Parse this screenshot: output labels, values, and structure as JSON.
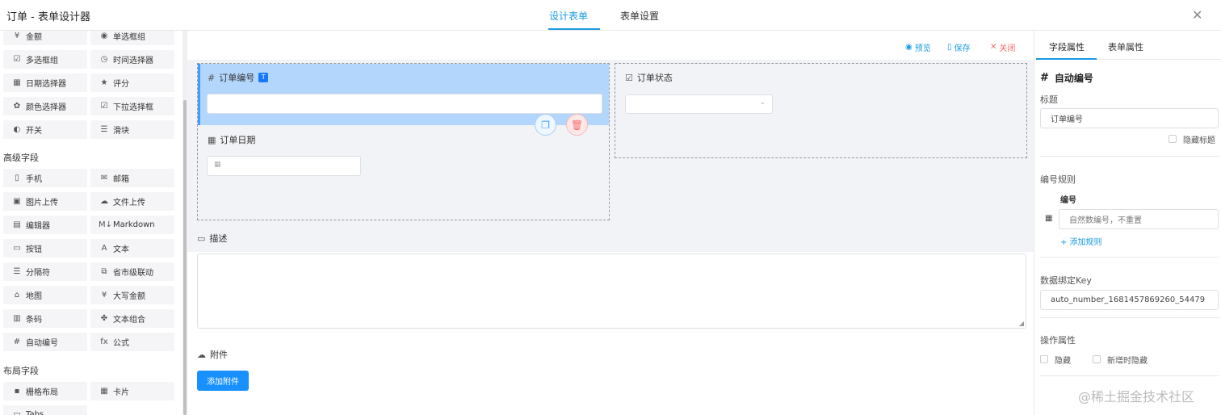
{
  "app": {
    "title": "订单 - 表单设计器",
    "close_glyph": "✕"
  },
  "top_tabs": [
    {
      "label": "设计表单",
      "active": true
    },
    {
      "label": "表单设置",
      "active": false
    }
  ],
  "sidebar": {
    "basic_items": [
      {
        "label": "金额",
        "icon": "money-icon"
      },
      {
        "label": "单选框组",
        "icon": "radio-icon"
      },
      {
        "label": "多选框组",
        "icon": "checkbox-icon"
      },
      {
        "label": "时间选择器",
        "icon": "clock-icon"
      },
      {
        "label": "日期选择器",
        "icon": "calendar-icon"
      },
      {
        "label": "评分",
        "icon": "star-icon"
      },
      {
        "label": "颜色选择器",
        "icon": "palette-icon"
      },
      {
        "label": "下拉选择框",
        "icon": "select-icon"
      },
      {
        "label": "开关",
        "icon": "switch-icon"
      },
      {
        "label": "滑块",
        "icon": "slider-icon"
      }
    ],
    "advanced_title": "高级字段",
    "advanced_items": [
      {
        "label": "手机",
        "icon": "phone-icon"
      },
      {
        "label": "邮箱",
        "icon": "mail-icon"
      },
      {
        "label": "图片上传",
        "icon": "image-icon"
      },
      {
        "label": "文件上传",
        "icon": "cloud-upload-icon"
      },
      {
        "label": "编辑器",
        "icon": "editor-icon"
      },
      {
        "label": "Markdown",
        "icon": "markdown-icon"
      },
      {
        "label": "按钮",
        "icon": "button-icon"
      },
      {
        "label": "文本",
        "icon": "text-icon"
      },
      {
        "label": "分隔符",
        "icon": "divider-icon"
      },
      {
        "label": "省市级联动",
        "icon": "cascade-icon"
      },
      {
        "label": "地图",
        "icon": "map-icon"
      },
      {
        "label": "大写金额",
        "icon": "money-upper-icon"
      },
      {
        "label": "条码",
        "icon": "barcode-icon"
      },
      {
        "label": "文本组合",
        "icon": "combine-icon"
      },
      {
        "label": "自动编号",
        "icon": "hash-icon"
      },
      {
        "label": "公式",
        "icon": "formula-icon"
      }
    ],
    "layout_title": "布局字段",
    "layout_items": [
      {
        "label": "栅格布局",
        "icon": "grid-icon"
      },
      {
        "label": "卡片",
        "icon": "card-icon"
      },
      {
        "label": "Tabs",
        "icon": "tabs-icon"
      }
    ]
  },
  "toolbar": {
    "preview": "预览",
    "save": "保存",
    "close": "关闭"
  },
  "canvas": {
    "field_order_no": {
      "label": "订单编号",
      "badge": "T"
    },
    "field_order_date": {
      "label": "订单日期"
    },
    "field_order_status": {
      "label": "订单状态"
    },
    "field_description": {
      "label": "描述"
    },
    "field_attachment": {
      "label": "附件",
      "button": "添加附件"
    }
  },
  "right_panel": {
    "tabs": [
      {
        "label": "字段属性",
        "active": true
      },
      {
        "label": "表单属性",
        "active": false
      }
    ],
    "field_type": "自动编号",
    "title_label": "标题",
    "title_value": "订单编号",
    "hide_title": "隐藏标题",
    "rule_label": "编号规则",
    "rule_column": "编号",
    "rule_placeholder": "自然数编号，不重置",
    "add_rule": "+ 添加规则",
    "key_label": "数据绑定Key",
    "key_value": "auto_number_1681457869260_54479",
    "ops_label": "操作属性",
    "hide": "隐藏",
    "hide_on_add": "新增时隐藏"
  },
  "watermark": "@稀土掘金技术社区",
  "colors": {
    "accent": "#1a9ae0",
    "selected_field": "#b3d7fc",
    "primary_button": "#1890ff",
    "danger": "#f56c6c"
  }
}
